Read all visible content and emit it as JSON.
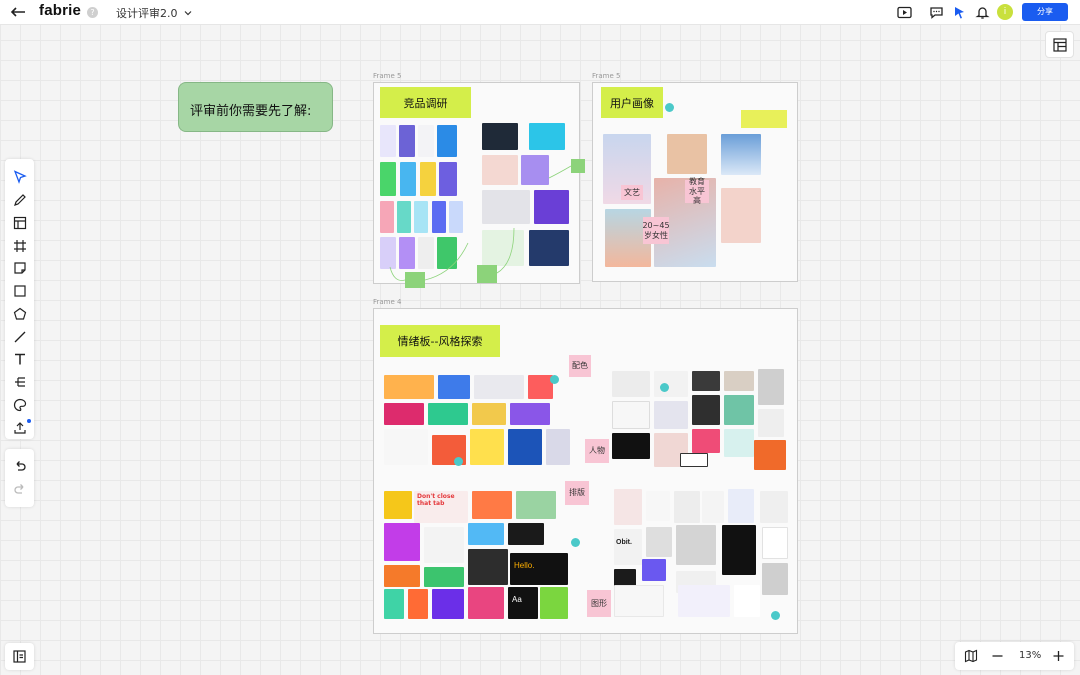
{
  "header": {
    "brand": "fabrie",
    "help": "?",
    "file_title": "设计评审2.0",
    "avatar_initial": "i",
    "share_label": "分享"
  },
  "sticky_note": {
    "text": "评审前你需要先了解:"
  },
  "frames": {
    "competitor": {
      "label": "Frame 5",
      "title": "竞品调研"
    },
    "persona": {
      "label": "Frame 5",
      "title": "用户画像"
    },
    "moodboard": {
      "label": "Frame 4",
      "title": "情绪板--风格探索"
    }
  },
  "persona_tags": {
    "wenyi": "文艺",
    "education": "教育水平高",
    "age": "20~45岁女性"
  },
  "moodboard_tags": {
    "color": "配色",
    "people": "人物",
    "layout": "排版",
    "graphics": "图形"
  },
  "typography_samples": {
    "dont_close": "Don't close that tab",
    "hello": "Hello.",
    "obit": "Obit.",
    "aa": "Aa"
  },
  "zoom": {
    "level": "13%"
  },
  "colors": {
    "accent": "#1a5cf0",
    "frame_title": "#d4ee4a",
    "sticky": "#a7d6a5",
    "tag": "#f8c5d4",
    "avatar": "#c9e03d"
  }
}
